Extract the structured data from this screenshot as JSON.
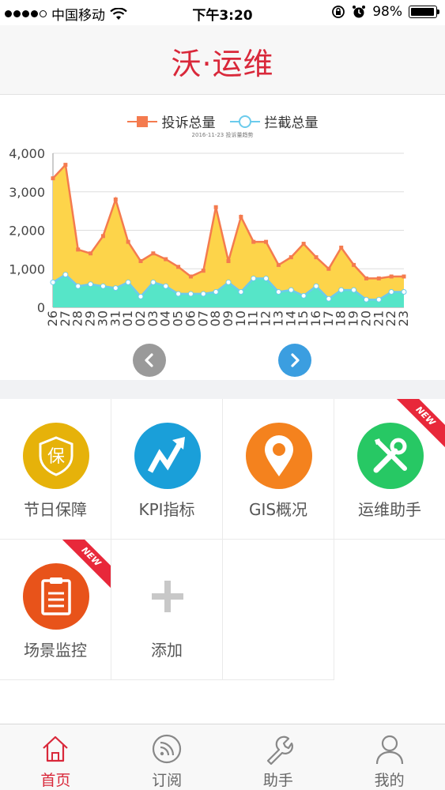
{
  "status_bar": {
    "carrier": "中国移动",
    "time": "下午3:20",
    "battery_text": "98%",
    "battery_level": 0.98
  },
  "nav": {
    "title": "沃·运维"
  },
  "chart_data": {
    "type": "area",
    "title": "",
    "subtitle": "2016-11-23 投诉量趋势",
    "categories": [
      "26",
      "27",
      "28",
      "29",
      "30",
      "31",
      "01",
      "02",
      "03",
      "04",
      "05",
      "06",
      "07",
      "08",
      "09",
      "10",
      "11",
      "12",
      "13",
      "14",
      "15",
      "16",
      "17",
      "18",
      "19",
      "20",
      "21",
      "22",
      "23"
    ],
    "series": [
      {
        "name": "投诉总量",
        "color": "#f47b4f",
        "fill": "#fdd44a",
        "values": [
          3350,
          3700,
          1500,
          1400,
          1850,
          2800,
          1700,
          1200,
          1400,
          1250,
          1050,
          800,
          950,
          2600,
          1200,
          2350,
          1700,
          1700,
          1100,
          1300,
          1650,
          1300,
          1000,
          1550,
          1100,
          750,
          750,
          800,
          800
        ]
      },
      {
        "name": "拦截总量",
        "color": "#6bcbec",
        "fill": "#56e5c8",
        "values": [
          650,
          850,
          550,
          600,
          550,
          500,
          650,
          280,
          650,
          550,
          350,
          350,
          350,
          400,
          650,
          400,
          750,
          750,
          400,
          450,
          300,
          550,
          220,
          450,
          450,
          200,
          200,
          400,
          400
        ]
      }
    ],
    "ylim": [
      0,
      4000
    ],
    "yticks": [
      "0",
      "1,000",
      "2,000",
      "3,000",
      "4,000"
    ],
    "grid": true,
    "legend": "top-center"
  },
  "grid": {
    "items": [
      {
        "label": "节日保障",
        "icon": "shield-icon",
        "color": "#e6b20a",
        "badge": ""
      },
      {
        "label": "KPI指标",
        "icon": "trend-up-icon",
        "color": "#1a9fd9",
        "badge": ""
      },
      {
        "label": "GIS概况",
        "icon": "map-pin-icon",
        "color": "#f4821e",
        "badge": ""
      },
      {
        "label": "运维助手",
        "icon": "tools-icon",
        "color": "#27c864",
        "badge": "NEW"
      },
      {
        "label": "场景监控",
        "icon": "clipboard-icon",
        "color": "#e8531a",
        "badge": "NEW"
      },
      {
        "label": "添加",
        "icon": "plus-icon",
        "color": "#c8c8c8",
        "badge": ""
      }
    ],
    "shield_char": "保"
  },
  "tabbar": {
    "items": [
      {
        "label": "首页",
        "icon": "home-icon",
        "active": true
      },
      {
        "label": "订阅",
        "icon": "rss-icon",
        "active": false
      },
      {
        "label": "助手",
        "icon": "wrench-icon",
        "active": false
      },
      {
        "label": "我的",
        "icon": "user-icon",
        "active": false
      }
    ]
  }
}
